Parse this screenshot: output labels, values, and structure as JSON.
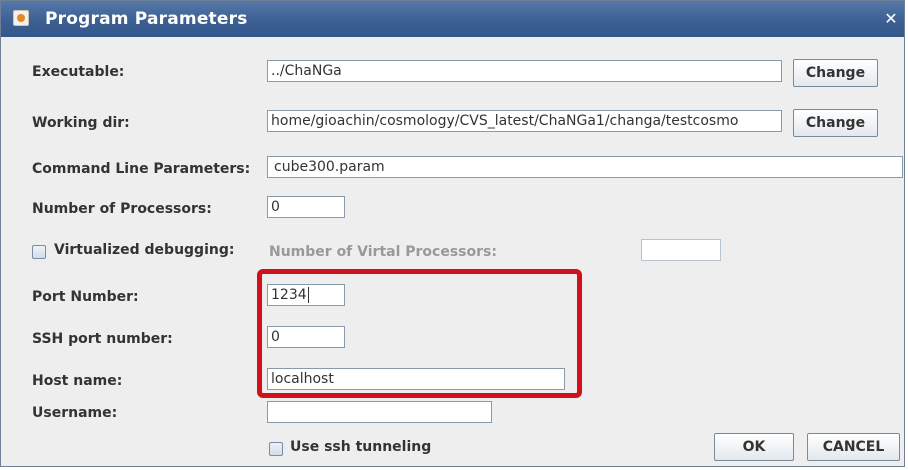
{
  "window": {
    "title": "Program Parameters",
    "close_glyph": "✕",
    "app_icon": "java-cup-icon"
  },
  "executable": {
    "label": "Executable:",
    "value": "../ChaNGa",
    "button": "Change"
  },
  "working_dir": {
    "label": "Working dir:",
    "value": "home/gioachin/cosmology/CVS_latest/ChaNGa1/changa/testcosmo",
    "button": "Change"
  },
  "command_line": {
    "label": "Command Line Parameters:",
    "value": "cube300.param"
  },
  "processors": {
    "label": "Number of Processors:",
    "value": "0"
  },
  "virtualized": {
    "label": "Virtualized debugging:",
    "checked": false,
    "virt_label": "Number of Virtal Processors:",
    "virt_value": ""
  },
  "port": {
    "label": "Port Number:",
    "value": "1234"
  },
  "ssh_port": {
    "label": "SSH port number:",
    "value": "0"
  },
  "host": {
    "label": "Host name:",
    "value": "localhost"
  },
  "username": {
    "label": "Username:",
    "value": ""
  },
  "ssh_tunnel": {
    "label": "Use ssh tunneling",
    "checked": false
  },
  "buttons": {
    "ok": "OK",
    "cancel": "CANCEL"
  },
  "colors": {
    "title_bar": "#3c6093",
    "highlight": "#d0101a",
    "background": "#eeeeee"
  }
}
